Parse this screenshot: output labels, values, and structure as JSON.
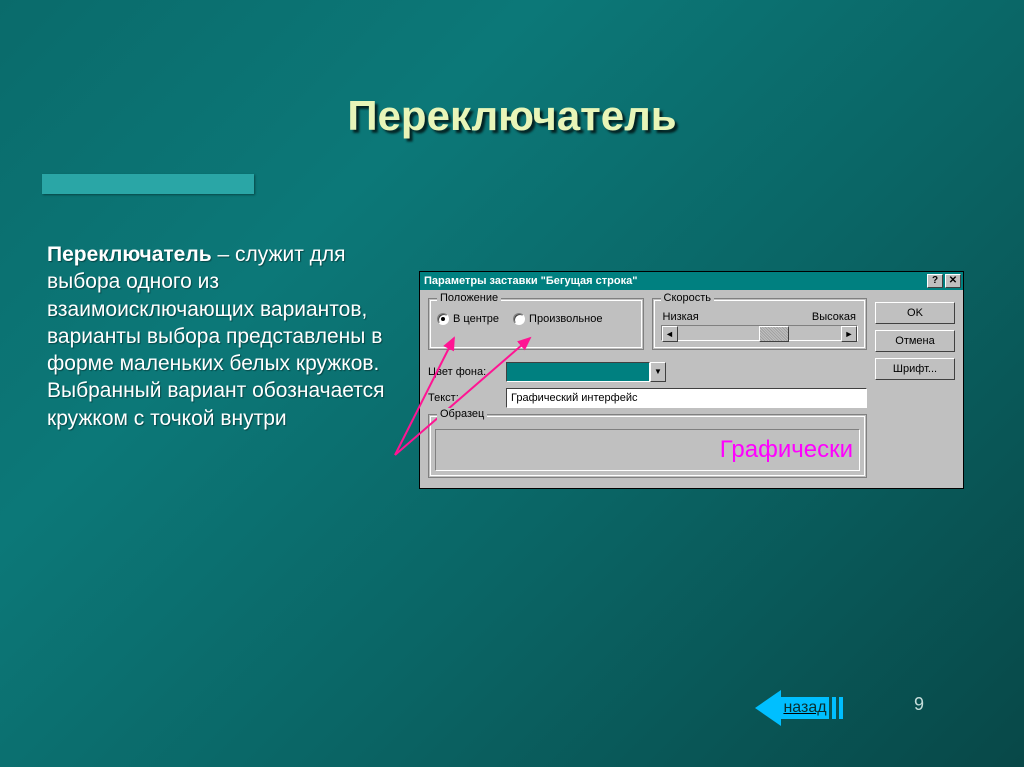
{
  "slide": {
    "title": "Переключатель",
    "body_bold": "Переключатель",
    "body_rest": " – служит для выбора одного из взаимоисключающих вариантов, варианты выбора представлены в форме маленьких белых кружков. Выбранный вариант обозначается кружком с точкой внутри",
    "page": "9",
    "back": "назад"
  },
  "dialog": {
    "title": "Параметры заставки \"Бегущая строка\"",
    "help_btn": "?",
    "close_btn": "✕",
    "buttons": {
      "ok": "OK",
      "cancel": "Отмена",
      "font": "Шрифт..."
    },
    "group_position": "Положение",
    "radio_center": "В центре",
    "radio_random": "Произвольное",
    "group_speed": "Скорость",
    "speed_low": "Низкая",
    "speed_high": "Высокая",
    "label_bgcolor": "Цвет фона:",
    "label_text": "Текст:",
    "text_value": "Графический интерфейс",
    "group_sample": "Образец",
    "sample_text": "Графически"
  }
}
